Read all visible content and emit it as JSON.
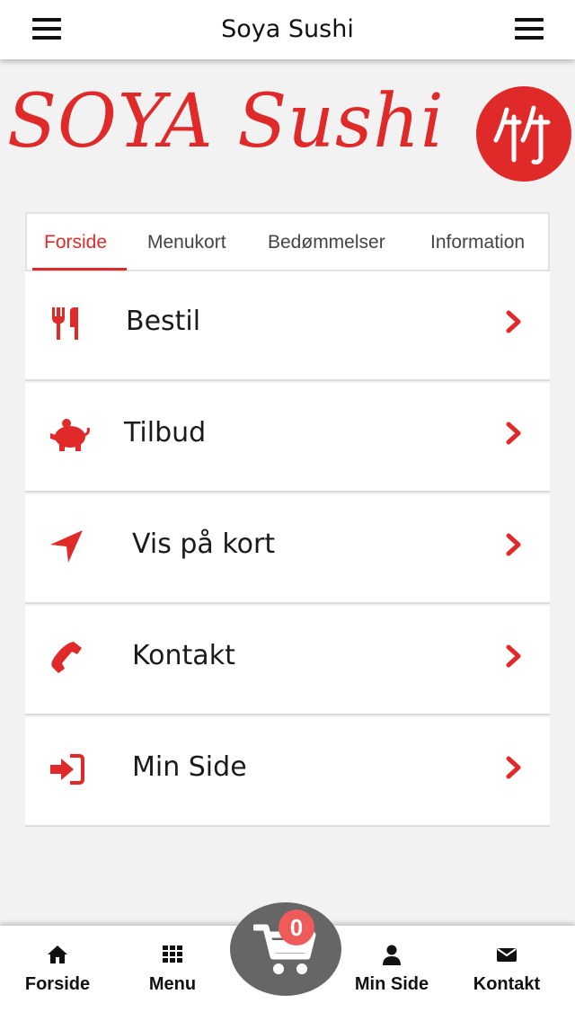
{
  "header": {
    "title": "Soya Sushi"
  },
  "logo": {
    "text": "SOYA Sushi"
  },
  "tabs": [
    {
      "label": "Forside",
      "active": true
    },
    {
      "label": "Menukort"
    },
    {
      "label": "Bedømmelser"
    },
    {
      "label": "Information"
    }
  ],
  "rows": [
    {
      "label": "Bestil",
      "icon": "utensils-icon"
    },
    {
      "label": "Tilbud",
      "icon": "piggy-bank-icon"
    },
    {
      "label": "Vis på kort",
      "icon": "location-arrow-icon"
    },
    {
      "label": "Kontakt",
      "icon": "phone-icon"
    },
    {
      "label": "Min Side",
      "icon": "sign-in-icon"
    }
  ],
  "bottom_nav": [
    {
      "label": "Forside",
      "icon": "home-icon"
    },
    {
      "label": "Menu",
      "icon": "grid-icon"
    },
    {
      "label": "Min Side",
      "icon": "user-icon"
    },
    {
      "label": "Kontakt",
      "icon": "envelope-icon"
    }
  ],
  "cart": {
    "count": "0"
  },
  "colors": {
    "accent": "#e02a2a",
    "cart_bg": "#666666",
    "badge": "#ef5a5a"
  }
}
